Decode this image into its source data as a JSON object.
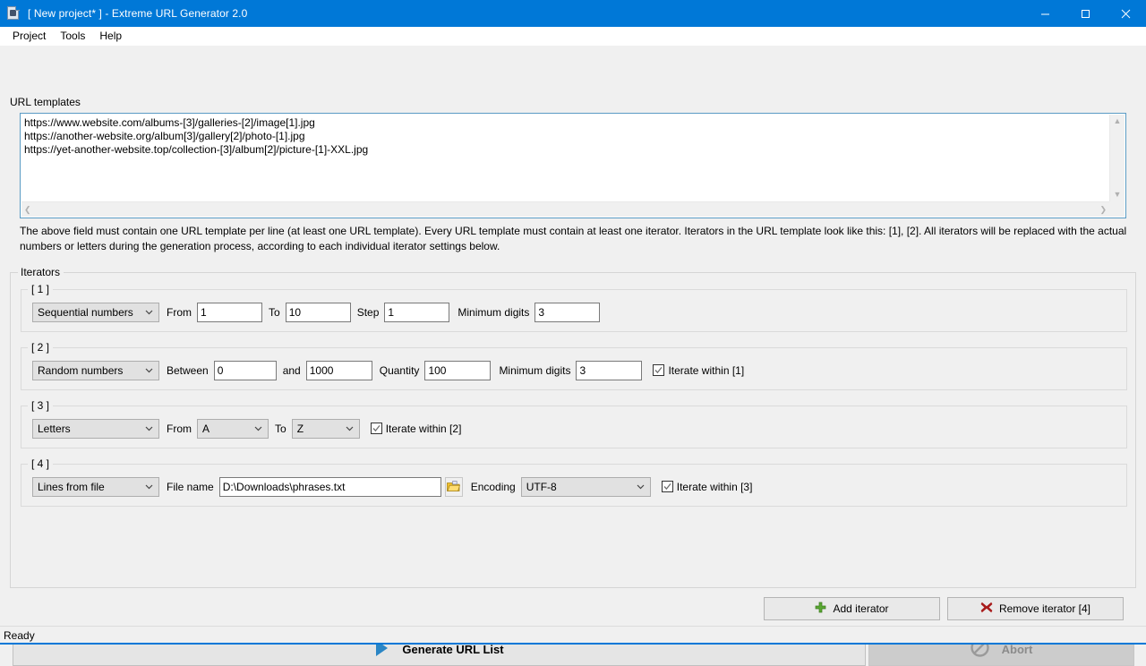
{
  "window": {
    "title": "[ New project* ] - Extreme URL Generator 2.0",
    "app_icon": "document-icon",
    "minimize_label": "–",
    "maximize_label": "□",
    "close_label": "✕",
    "titlebar_color": "#0078d7"
  },
  "menubar": {
    "items": [
      {
        "label": "Project"
      },
      {
        "label": "Tools"
      },
      {
        "label": "Help"
      }
    ]
  },
  "url_templates": {
    "group_label": "URL templates",
    "value": "https://www.website.com/albums-[3]/galleries-[2]/image[1].jpg\nhttps://another-website.org/album[3]/gallery[2]/photo-[1].jpg\nhttps://yet-another-website.top/collection-[3]/album[2]/picture-[1]-XXL.jpg",
    "lines": [
      "https://www.website.com/albums-[3]/galleries-[2]/image[1].jpg",
      "https://another-website.org/album[3]/gallery[2]/photo-[1].jpg",
      "https://yet-another-website.top/collection-[3]/album[2]/picture-[1]-XXL.jpg"
    ],
    "scroll_up": "▲",
    "scroll_down": "▼",
    "scroll_left": "❮",
    "scroll_right": "❯",
    "description": "The above field must contain one URL template per line (at least one URL template). Every URL template must contain at least one iterator. Iterators in the URL template look like this: [1], [2]. All iterators will be replaced with the actual numbers or letters during the generation process, according to each individual iterator settings below."
  },
  "iterators": {
    "group_label": "Iterators",
    "items": [
      {
        "label": "[ 1 ]",
        "type": "Sequential numbers",
        "fields": [
          {
            "label": "From",
            "value": "1"
          },
          {
            "label": "To",
            "value": "10"
          },
          {
            "label": "Step",
            "value": "1"
          },
          {
            "label": "Minimum digits",
            "value": "3"
          }
        ],
        "iterate_within": null,
        "iterate_within_checked": false
      },
      {
        "label": "[ 2 ]",
        "type": "Random numbers",
        "fields": [
          {
            "label": "Between",
            "value": "0"
          },
          {
            "label": "and",
            "value": "1000"
          },
          {
            "label": "Quantity",
            "value": "100"
          },
          {
            "label": "Minimum digits",
            "value": "3"
          }
        ],
        "iterate_within": "Iterate within [1]",
        "iterate_within_checked": true
      },
      {
        "label": "[ 3 ]",
        "type": "Letters",
        "fields": [
          {
            "label": "From",
            "value": "A"
          },
          {
            "label": "To",
            "value": "Z"
          }
        ],
        "iterate_within": "Iterate within [2]",
        "iterate_within_checked": true
      },
      {
        "label": "[ 4 ]",
        "type": "Lines from file",
        "fields": [
          {
            "label": "File name",
            "value": "D:\\Downloads\\phrases.txt"
          },
          {
            "label": "Encoding",
            "value": "UTF-8"
          }
        ],
        "browse_icon": "folder-open-icon",
        "iterate_within": "Iterate within [3]",
        "iterate_within_checked": true
      }
    ],
    "add_label": "Add iterator",
    "add_icon": "plus-icon",
    "remove_label": "Remove iterator [4]",
    "remove_icon": "cross-icon"
  },
  "actions": {
    "generate_label": "Generate URL List",
    "generate_icon": "play-icon",
    "abort_label": "Abort",
    "abort_icon": "no-entry-icon",
    "abort_enabled": false
  },
  "statusbar": {
    "text": "Ready"
  },
  "colors": {
    "accent": "#0078d7",
    "window_bg": "#f0f0f0",
    "field_bg": "#ffffff",
    "combo_bg": "#e1e1e1",
    "plus_green": "#5aa832",
    "cross_red": "#a81b1b",
    "play_blue": "#2b86c5",
    "folder_yellow": "#f2c12e"
  }
}
